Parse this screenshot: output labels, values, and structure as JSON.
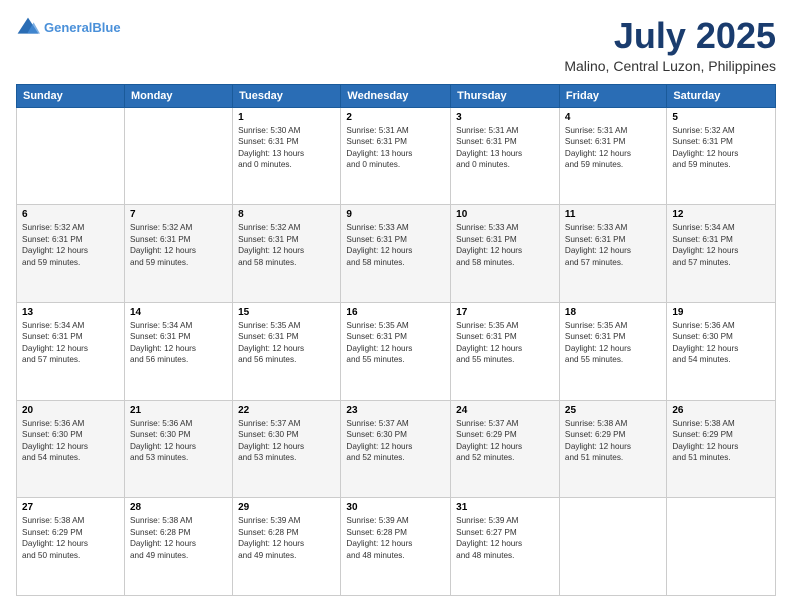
{
  "header": {
    "logo_line1": "General",
    "logo_line2": "Blue",
    "title": "July 2025",
    "subtitle": "Malino, Central Luzon, Philippines"
  },
  "weekdays": [
    "Sunday",
    "Monday",
    "Tuesday",
    "Wednesday",
    "Thursday",
    "Friday",
    "Saturday"
  ],
  "weeks": [
    [
      {
        "day": "",
        "info": ""
      },
      {
        "day": "",
        "info": ""
      },
      {
        "day": "1",
        "info": "Sunrise: 5:30 AM\nSunset: 6:31 PM\nDaylight: 13 hours\nand 0 minutes."
      },
      {
        "day": "2",
        "info": "Sunrise: 5:31 AM\nSunset: 6:31 PM\nDaylight: 13 hours\nand 0 minutes."
      },
      {
        "day": "3",
        "info": "Sunrise: 5:31 AM\nSunset: 6:31 PM\nDaylight: 13 hours\nand 0 minutes."
      },
      {
        "day": "4",
        "info": "Sunrise: 5:31 AM\nSunset: 6:31 PM\nDaylight: 12 hours\nand 59 minutes."
      },
      {
        "day": "5",
        "info": "Sunrise: 5:32 AM\nSunset: 6:31 PM\nDaylight: 12 hours\nand 59 minutes."
      }
    ],
    [
      {
        "day": "6",
        "info": "Sunrise: 5:32 AM\nSunset: 6:31 PM\nDaylight: 12 hours\nand 59 minutes."
      },
      {
        "day": "7",
        "info": "Sunrise: 5:32 AM\nSunset: 6:31 PM\nDaylight: 12 hours\nand 59 minutes."
      },
      {
        "day": "8",
        "info": "Sunrise: 5:32 AM\nSunset: 6:31 PM\nDaylight: 12 hours\nand 58 minutes."
      },
      {
        "day": "9",
        "info": "Sunrise: 5:33 AM\nSunset: 6:31 PM\nDaylight: 12 hours\nand 58 minutes."
      },
      {
        "day": "10",
        "info": "Sunrise: 5:33 AM\nSunset: 6:31 PM\nDaylight: 12 hours\nand 58 minutes."
      },
      {
        "day": "11",
        "info": "Sunrise: 5:33 AM\nSunset: 6:31 PM\nDaylight: 12 hours\nand 57 minutes."
      },
      {
        "day": "12",
        "info": "Sunrise: 5:34 AM\nSunset: 6:31 PM\nDaylight: 12 hours\nand 57 minutes."
      }
    ],
    [
      {
        "day": "13",
        "info": "Sunrise: 5:34 AM\nSunset: 6:31 PM\nDaylight: 12 hours\nand 57 minutes."
      },
      {
        "day": "14",
        "info": "Sunrise: 5:34 AM\nSunset: 6:31 PM\nDaylight: 12 hours\nand 56 minutes."
      },
      {
        "day": "15",
        "info": "Sunrise: 5:35 AM\nSunset: 6:31 PM\nDaylight: 12 hours\nand 56 minutes."
      },
      {
        "day": "16",
        "info": "Sunrise: 5:35 AM\nSunset: 6:31 PM\nDaylight: 12 hours\nand 55 minutes."
      },
      {
        "day": "17",
        "info": "Sunrise: 5:35 AM\nSunset: 6:31 PM\nDaylight: 12 hours\nand 55 minutes."
      },
      {
        "day": "18",
        "info": "Sunrise: 5:35 AM\nSunset: 6:31 PM\nDaylight: 12 hours\nand 55 minutes."
      },
      {
        "day": "19",
        "info": "Sunrise: 5:36 AM\nSunset: 6:30 PM\nDaylight: 12 hours\nand 54 minutes."
      }
    ],
    [
      {
        "day": "20",
        "info": "Sunrise: 5:36 AM\nSunset: 6:30 PM\nDaylight: 12 hours\nand 54 minutes."
      },
      {
        "day": "21",
        "info": "Sunrise: 5:36 AM\nSunset: 6:30 PM\nDaylight: 12 hours\nand 53 minutes."
      },
      {
        "day": "22",
        "info": "Sunrise: 5:37 AM\nSunset: 6:30 PM\nDaylight: 12 hours\nand 53 minutes."
      },
      {
        "day": "23",
        "info": "Sunrise: 5:37 AM\nSunset: 6:30 PM\nDaylight: 12 hours\nand 52 minutes."
      },
      {
        "day": "24",
        "info": "Sunrise: 5:37 AM\nSunset: 6:29 PM\nDaylight: 12 hours\nand 52 minutes."
      },
      {
        "day": "25",
        "info": "Sunrise: 5:38 AM\nSunset: 6:29 PM\nDaylight: 12 hours\nand 51 minutes."
      },
      {
        "day": "26",
        "info": "Sunrise: 5:38 AM\nSunset: 6:29 PM\nDaylight: 12 hours\nand 51 minutes."
      }
    ],
    [
      {
        "day": "27",
        "info": "Sunrise: 5:38 AM\nSunset: 6:29 PM\nDaylight: 12 hours\nand 50 minutes."
      },
      {
        "day": "28",
        "info": "Sunrise: 5:38 AM\nSunset: 6:28 PM\nDaylight: 12 hours\nand 49 minutes."
      },
      {
        "day": "29",
        "info": "Sunrise: 5:39 AM\nSunset: 6:28 PM\nDaylight: 12 hours\nand 49 minutes."
      },
      {
        "day": "30",
        "info": "Sunrise: 5:39 AM\nSunset: 6:28 PM\nDaylight: 12 hours\nand 48 minutes."
      },
      {
        "day": "31",
        "info": "Sunrise: 5:39 AM\nSunset: 6:27 PM\nDaylight: 12 hours\nand 48 minutes."
      },
      {
        "day": "",
        "info": ""
      },
      {
        "day": "",
        "info": ""
      }
    ]
  ]
}
